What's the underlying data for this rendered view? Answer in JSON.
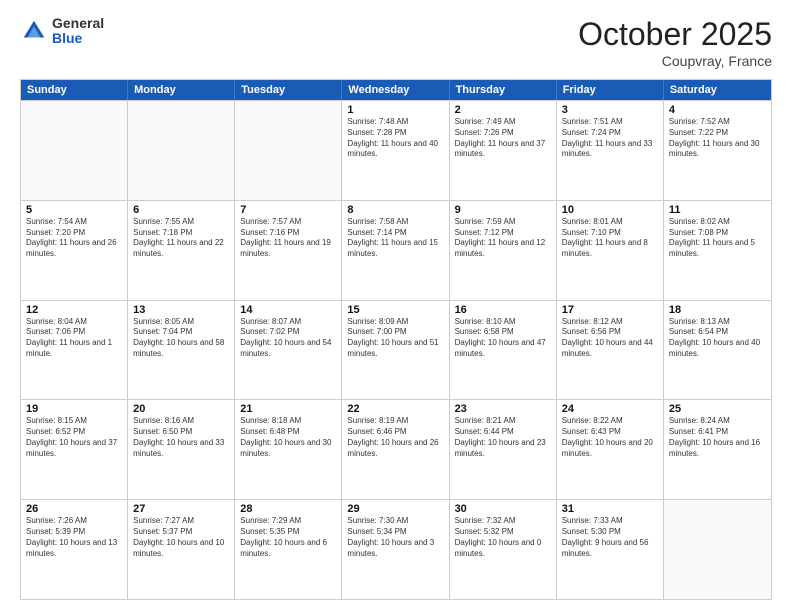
{
  "header": {
    "logo": {
      "general": "General",
      "blue": "Blue"
    },
    "month": "October 2025",
    "location": "Coupvray, France"
  },
  "weekdays": [
    "Sunday",
    "Monday",
    "Tuesday",
    "Wednesday",
    "Thursday",
    "Friday",
    "Saturday"
  ],
  "rows": [
    [
      {
        "day": "",
        "empty": true
      },
      {
        "day": "",
        "empty": true
      },
      {
        "day": "",
        "empty": true
      },
      {
        "day": "1",
        "sunrise": "Sunrise: 7:48 AM",
        "sunset": "Sunset: 7:28 PM",
        "daylight": "Daylight: 11 hours and 40 minutes."
      },
      {
        "day": "2",
        "sunrise": "Sunrise: 7:49 AM",
        "sunset": "Sunset: 7:26 PM",
        "daylight": "Daylight: 11 hours and 37 minutes."
      },
      {
        "day": "3",
        "sunrise": "Sunrise: 7:51 AM",
        "sunset": "Sunset: 7:24 PM",
        "daylight": "Daylight: 11 hours and 33 minutes."
      },
      {
        "day": "4",
        "sunrise": "Sunrise: 7:52 AM",
        "sunset": "Sunset: 7:22 PM",
        "daylight": "Daylight: 11 hours and 30 minutes."
      }
    ],
    [
      {
        "day": "5",
        "sunrise": "Sunrise: 7:54 AM",
        "sunset": "Sunset: 7:20 PM",
        "daylight": "Daylight: 11 hours and 26 minutes."
      },
      {
        "day": "6",
        "sunrise": "Sunrise: 7:55 AM",
        "sunset": "Sunset: 7:18 PM",
        "daylight": "Daylight: 11 hours and 22 minutes."
      },
      {
        "day": "7",
        "sunrise": "Sunrise: 7:57 AM",
        "sunset": "Sunset: 7:16 PM",
        "daylight": "Daylight: 11 hours and 19 minutes."
      },
      {
        "day": "8",
        "sunrise": "Sunrise: 7:58 AM",
        "sunset": "Sunset: 7:14 PM",
        "daylight": "Daylight: 11 hours and 15 minutes."
      },
      {
        "day": "9",
        "sunrise": "Sunrise: 7:59 AM",
        "sunset": "Sunset: 7:12 PM",
        "daylight": "Daylight: 11 hours and 12 minutes."
      },
      {
        "day": "10",
        "sunrise": "Sunrise: 8:01 AM",
        "sunset": "Sunset: 7:10 PM",
        "daylight": "Daylight: 11 hours and 8 minutes."
      },
      {
        "day": "11",
        "sunrise": "Sunrise: 8:02 AM",
        "sunset": "Sunset: 7:08 PM",
        "daylight": "Daylight: 11 hours and 5 minutes."
      }
    ],
    [
      {
        "day": "12",
        "sunrise": "Sunrise: 8:04 AM",
        "sunset": "Sunset: 7:06 PM",
        "daylight": "Daylight: 11 hours and 1 minute."
      },
      {
        "day": "13",
        "sunrise": "Sunrise: 8:05 AM",
        "sunset": "Sunset: 7:04 PM",
        "daylight": "Daylight: 10 hours and 58 minutes."
      },
      {
        "day": "14",
        "sunrise": "Sunrise: 8:07 AM",
        "sunset": "Sunset: 7:02 PM",
        "daylight": "Daylight: 10 hours and 54 minutes."
      },
      {
        "day": "15",
        "sunrise": "Sunrise: 8:09 AM",
        "sunset": "Sunset: 7:00 PM",
        "daylight": "Daylight: 10 hours and 51 minutes."
      },
      {
        "day": "16",
        "sunrise": "Sunrise: 8:10 AM",
        "sunset": "Sunset: 6:58 PM",
        "daylight": "Daylight: 10 hours and 47 minutes."
      },
      {
        "day": "17",
        "sunrise": "Sunrise: 8:12 AM",
        "sunset": "Sunset: 6:56 PM",
        "daylight": "Daylight: 10 hours and 44 minutes."
      },
      {
        "day": "18",
        "sunrise": "Sunrise: 8:13 AM",
        "sunset": "Sunset: 6:54 PM",
        "daylight": "Daylight: 10 hours and 40 minutes."
      }
    ],
    [
      {
        "day": "19",
        "sunrise": "Sunrise: 8:15 AM",
        "sunset": "Sunset: 6:52 PM",
        "daylight": "Daylight: 10 hours and 37 minutes."
      },
      {
        "day": "20",
        "sunrise": "Sunrise: 8:16 AM",
        "sunset": "Sunset: 6:50 PM",
        "daylight": "Daylight: 10 hours and 33 minutes."
      },
      {
        "day": "21",
        "sunrise": "Sunrise: 8:18 AM",
        "sunset": "Sunset: 6:48 PM",
        "daylight": "Daylight: 10 hours and 30 minutes."
      },
      {
        "day": "22",
        "sunrise": "Sunrise: 8:19 AM",
        "sunset": "Sunset: 6:46 PM",
        "daylight": "Daylight: 10 hours and 26 minutes."
      },
      {
        "day": "23",
        "sunrise": "Sunrise: 8:21 AM",
        "sunset": "Sunset: 6:44 PM",
        "daylight": "Daylight: 10 hours and 23 minutes."
      },
      {
        "day": "24",
        "sunrise": "Sunrise: 8:22 AM",
        "sunset": "Sunset: 6:43 PM",
        "daylight": "Daylight: 10 hours and 20 minutes."
      },
      {
        "day": "25",
        "sunrise": "Sunrise: 8:24 AM",
        "sunset": "Sunset: 6:41 PM",
        "daylight": "Daylight: 10 hours and 16 minutes."
      }
    ],
    [
      {
        "day": "26",
        "sunrise": "Sunrise: 7:26 AM",
        "sunset": "Sunset: 5:39 PM",
        "daylight": "Daylight: 10 hours and 13 minutes."
      },
      {
        "day": "27",
        "sunrise": "Sunrise: 7:27 AM",
        "sunset": "Sunset: 5:37 PM",
        "daylight": "Daylight: 10 hours and 10 minutes."
      },
      {
        "day": "28",
        "sunrise": "Sunrise: 7:29 AM",
        "sunset": "Sunset: 5:35 PM",
        "daylight": "Daylight: 10 hours and 6 minutes."
      },
      {
        "day": "29",
        "sunrise": "Sunrise: 7:30 AM",
        "sunset": "Sunset: 5:34 PM",
        "daylight": "Daylight: 10 hours and 3 minutes."
      },
      {
        "day": "30",
        "sunrise": "Sunrise: 7:32 AM",
        "sunset": "Sunset: 5:32 PM",
        "daylight": "Daylight: 10 hours and 0 minutes."
      },
      {
        "day": "31",
        "sunrise": "Sunrise: 7:33 AM",
        "sunset": "Sunset: 5:30 PM",
        "daylight": "Daylight: 9 hours and 56 minutes."
      },
      {
        "day": "",
        "empty": true
      }
    ]
  ]
}
